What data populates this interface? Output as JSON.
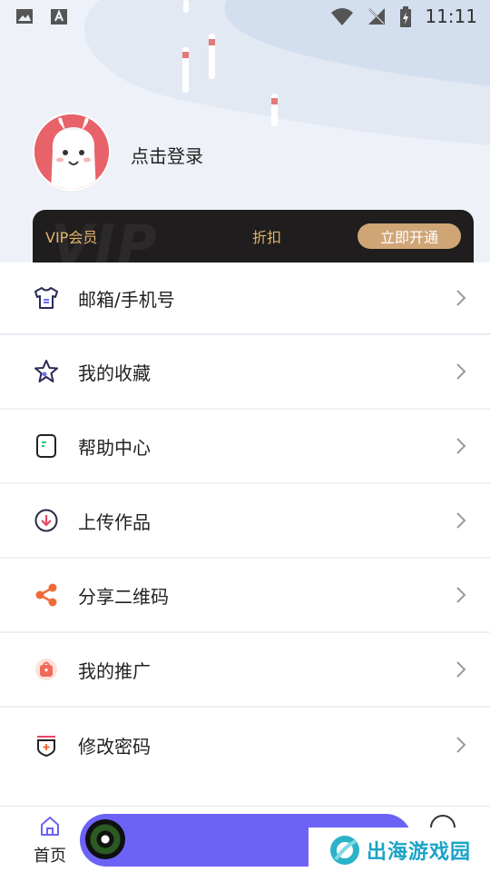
{
  "status_bar": {
    "time": "11:11",
    "left_icons": [
      "image-icon",
      "font-icon"
    ],
    "right_icons": [
      "wifi-icon",
      "no-signal-icon",
      "battery-charging-icon"
    ]
  },
  "profile": {
    "login_text": "点击登录",
    "avatar": "alpaca-avatar"
  },
  "vip": {
    "label": "VIP会员",
    "watermark": "VIP",
    "discount": "折扣",
    "button": "立即开通",
    "colors": {
      "background": "#1f1d1d",
      "text": "#e2b46c",
      "button": "#cfa576"
    }
  },
  "menu": {
    "items": [
      {
        "icon": "shirt-icon",
        "label": "邮箱/手机号"
      },
      {
        "icon": "star-icon",
        "label": "我的收藏"
      },
      {
        "icon": "document-icon",
        "label": "帮助中心"
      },
      {
        "icon": "download-icon",
        "label": "上传作品"
      },
      {
        "icon": "share-icon",
        "label": "分享二维码"
      },
      {
        "icon": "gift-bag-icon",
        "label": "我的推广"
      },
      {
        "icon": "shield-plus-icon",
        "label": "修改密码"
      }
    ]
  },
  "bottom_nav": {
    "home_label": "首页",
    "player_color": "#6c63f6"
  },
  "watermark": {
    "text": "出海游戏园"
  }
}
